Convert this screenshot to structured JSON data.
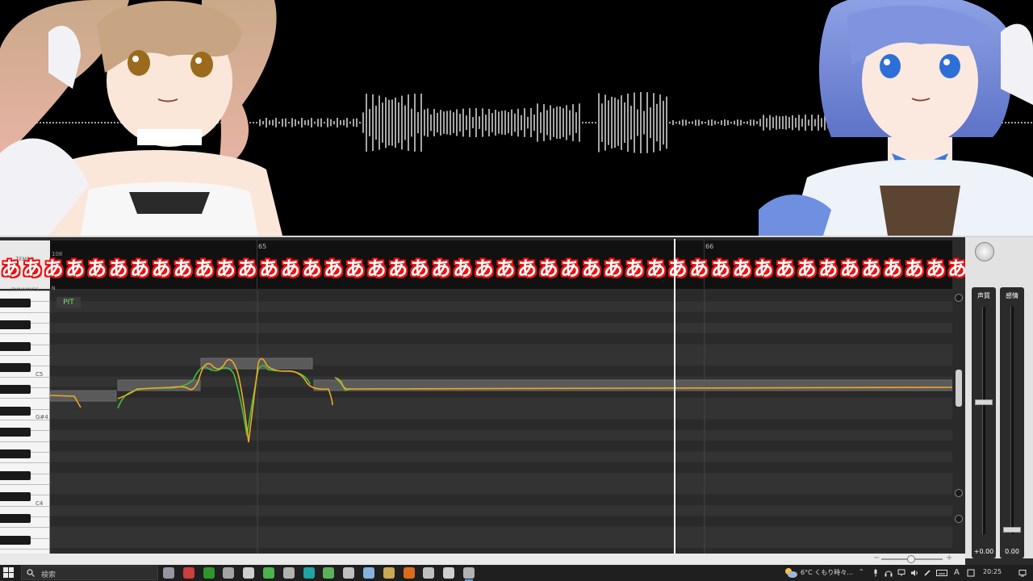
{
  "editor": {
    "track_labels": {
      "tempo": "TEMPO",
      "dynamics": "DYNAMICS"
    },
    "tempo_value": "108",
    "dynamics_value": "N",
    "bars": [
      "65",
      "66"
    ],
    "pitch_param_label": "PIT",
    "key_labels": [
      "C5",
      "G#4",
      "C4"
    ],
    "lyric_char": "あ",
    "lyric_count": 48
  },
  "mixer": {
    "faders": [
      {
        "title": "声質",
        "value": "+0.00",
        "level": 0.58
      },
      {
        "title": "感情",
        "value": "0.00",
        "level": 0.02
      }
    ]
  },
  "taskbar": {
    "search_placeholder": "検索",
    "weather": "6°C くもり時々…",
    "ime_indicator": "A",
    "time": "20:25",
    "apps": [
      "task-view",
      "chrome",
      "app-shield",
      "app-clock",
      "app-terminal",
      "app-green",
      "app-pen",
      "app-teal",
      "app-graph",
      "app-circle",
      "app-monitor",
      "app-folder",
      "firefox",
      "app-pause",
      "app-obs",
      "app-editor-active"
    ]
  },
  "colors": {
    "pitch_original": "#f0a823",
    "pitch_target": "#3fbf3f",
    "lyric_outline": "#e8131a",
    "playhead": "#ffffff"
  }
}
